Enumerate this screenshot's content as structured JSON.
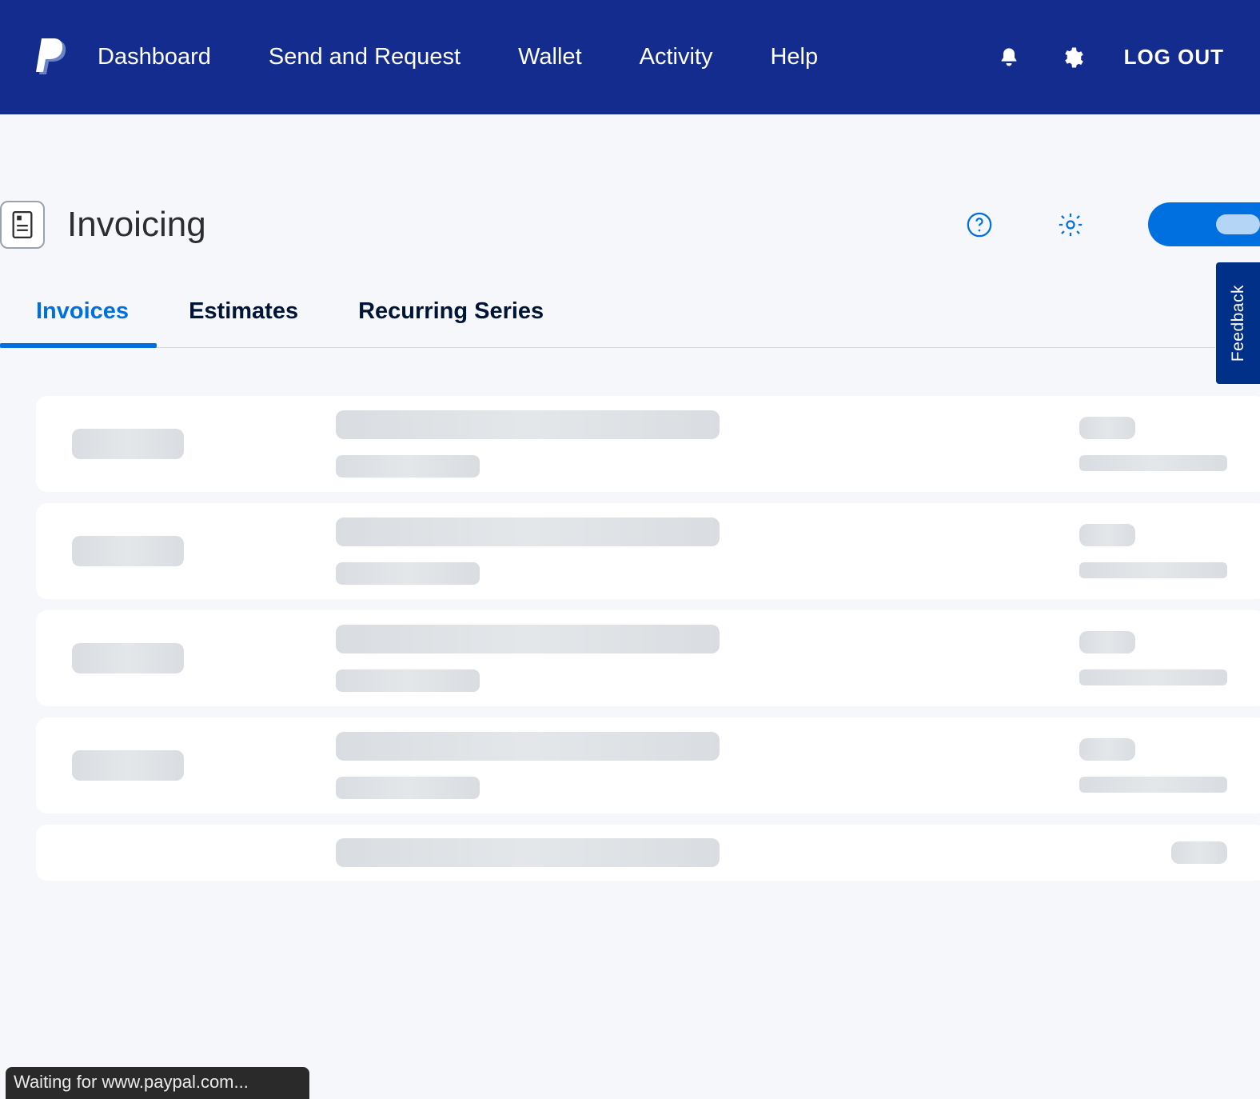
{
  "nav": {
    "items": [
      "Dashboard",
      "Send and Request",
      "Wallet",
      "Activity",
      "Help"
    ],
    "logout": "LOG OUT"
  },
  "page": {
    "title": "Invoicing"
  },
  "tabs": {
    "items": [
      "Invoices",
      "Estimates",
      "Recurring Series"
    ],
    "active_index": 0
  },
  "feedback": {
    "label": "Feedback"
  },
  "status": {
    "text": "Waiting for www.paypal.com..."
  }
}
